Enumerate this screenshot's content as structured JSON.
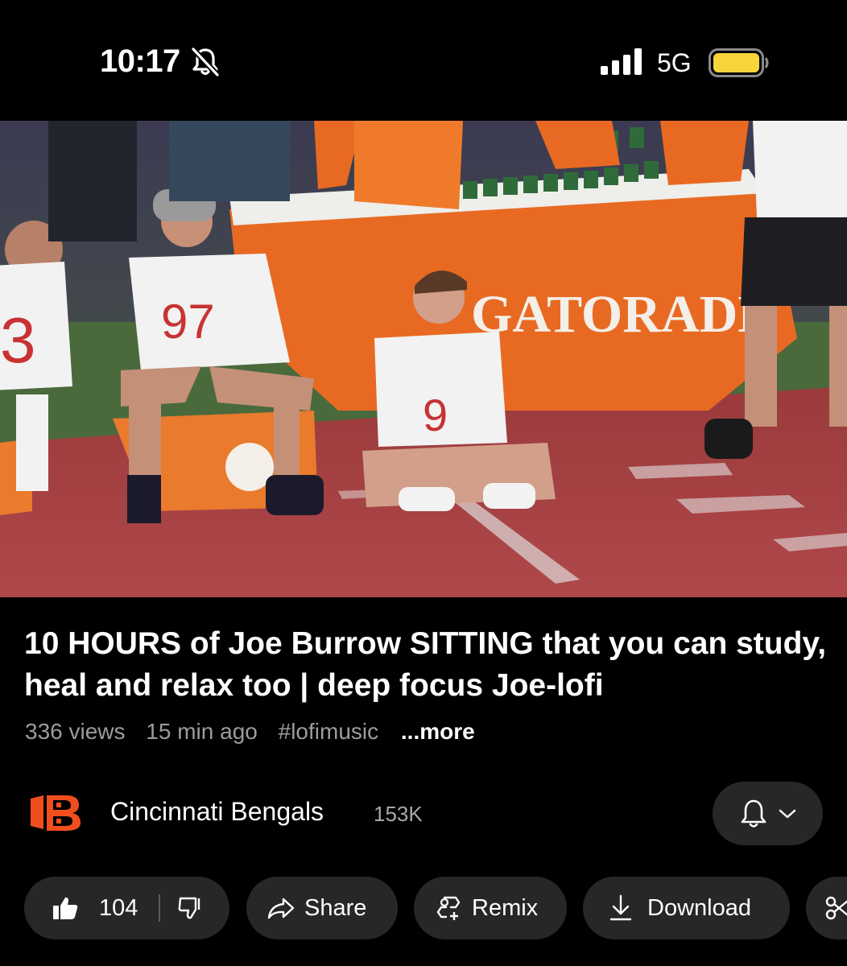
{
  "status_bar": {
    "time": "10:17",
    "network": "5G",
    "battery_color": "#f5d53a"
  },
  "video": {
    "thumbnail_icon": "video-frame"
  },
  "title": "10 HOURS of Joe Burrow SITTING that you can study, heal and relax too | deep focus Joe-lofi",
  "meta": {
    "views": "336 views",
    "age": "15 min ago",
    "hashtag": "#lofimusic",
    "more": "...more"
  },
  "channel": {
    "name": "Cincinnati Bengals",
    "subscribers": "153K",
    "logo_color": "#f04e1d"
  },
  "actions": {
    "like_count": "104",
    "share": "Share",
    "remix": "Remix",
    "download": "Download"
  }
}
